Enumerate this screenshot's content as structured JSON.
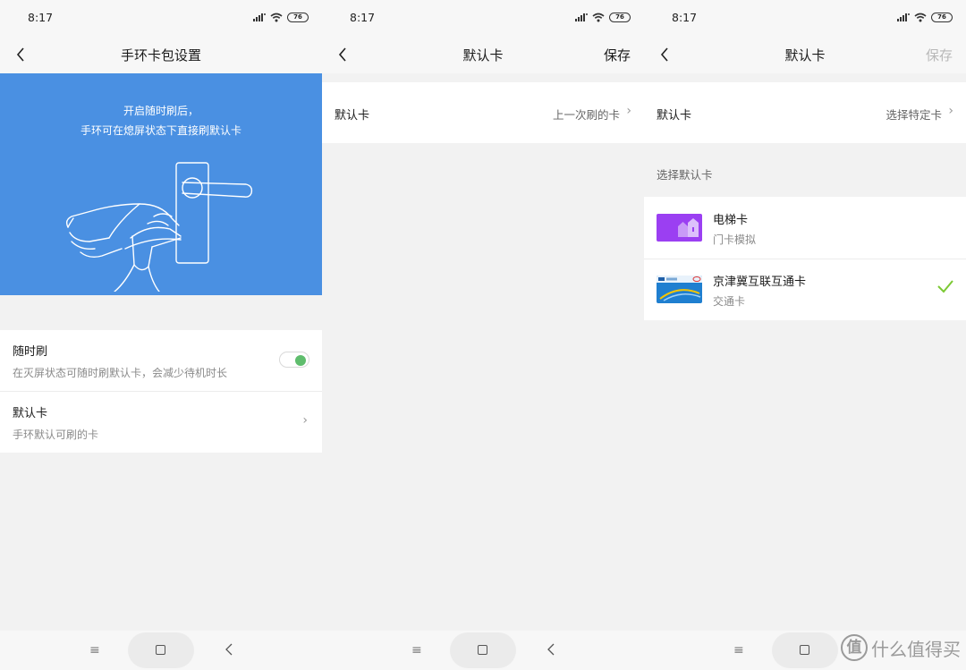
{
  "status": {
    "time": "8:17",
    "battery": "76"
  },
  "screen1": {
    "title": "手环卡包设置",
    "banner_line1": "开启随时刷后，",
    "banner_line2": "手环可在熄屏状态下直接刷默认卡",
    "quick_swipe": {
      "title": "随时刷",
      "subtitle": "在灭屏状态可随时刷默认卡，会减少待机时长",
      "enabled": true
    },
    "default_card": {
      "title": "默认卡",
      "subtitle": "手环默认可刷的卡",
      "chevron": "›"
    }
  },
  "screen2": {
    "title": "默认卡",
    "save_label": "保存",
    "default_label": "默认卡",
    "default_value": "上一次刷的卡",
    "chevron": "›"
  },
  "screen3": {
    "title": "默认卡",
    "save_label": "保存",
    "default_label": "默认卡",
    "default_value": "选择特定卡",
    "chevron": "›",
    "section_title": "选择默认卡",
    "cards": [
      {
        "name": "电梯卡",
        "type": "门卡模拟",
        "selected": false
      },
      {
        "name": "京津冀互联互通卡",
        "type": "交通卡",
        "selected": true
      }
    ]
  },
  "bottom_nav": {
    "menu_glyph": "≡"
  },
  "watermark": {
    "glyph": "值",
    "text": "什么值得买"
  },
  "colors": {
    "banner": "#4a90e2",
    "toggle_on": "#5fbd6d",
    "check": "#7cc934",
    "elevator_card": "#9b3ff2",
    "transit_card": "#1f7fd0"
  }
}
